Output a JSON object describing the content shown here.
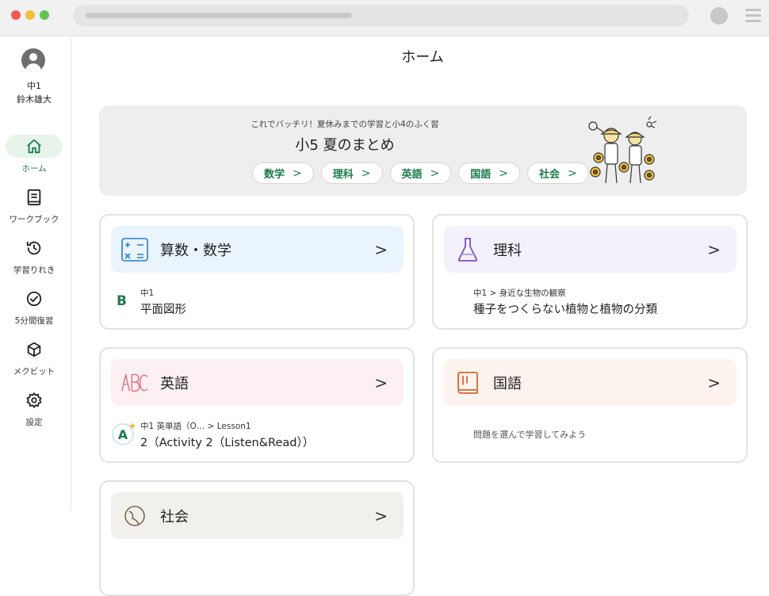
{
  "browser": {},
  "user": {
    "grade": "中1",
    "name": "鈴木雄大"
  },
  "nav": [
    {
      "label": "ホーム",
      "icon": "home-icon",
      "active": true
    },
    {
      "label": "ワークブック",
      "icon": "workbook-icon"
    },
    {
      "label": "学習りれき",
      "icon": "history-icon"
    },
    {
      "label": "5分間復習",
      "icon": "check-circle-icon"
    },
    {
      "label": "メクビット",
      "icon": "cube-icon"
    },
    {
      "label": "設定",
      "icon": "gear-icon"
    }
  ],
  "page_title": "ホーム",
  "banner": {
    "subtitle": "これでバッチリ！夏休みまでの学習と小4のふく習",
    "title": "小5 夏のまとめ",
    "pills": [
      "数学",
      "理科",
      "英語",
      "国語",
      "社会"
    ]
  },
  "cards": {
    "math": {
      "name": "算数・数学",
      "badge": "B",
      "meta": "中1",
      "main": "平面図形"
    },
    "science": {
      "name": "理科",
      "meta": "中1 > 身近な生物の観察",
      "main": "種子をつくらない植物と植物の分類"
    },
    "english": {
      "name": "英語",
      "badge": "A",
      "meta": "中1 英単語（O… > Lesson1",
      "main": "2（Activity 2（Listen&Read））"
    },
    "japanese": {
      "name": "国語",
      "hint": "問題を選んで学習してみよう"
    },
    "social": {
      "name": "社会"
    }
  },
  "colors": {
    "accent_green": "#1e7c4b",
    "math_bg": "#eaf4fd",
    "science_bg": "#f3f1fb",
    "english_bg": "#fdf0f2",
    "japanese_bg": "#fdf3ee",
    "social_bg": "#f2f0ec"
  }
}
